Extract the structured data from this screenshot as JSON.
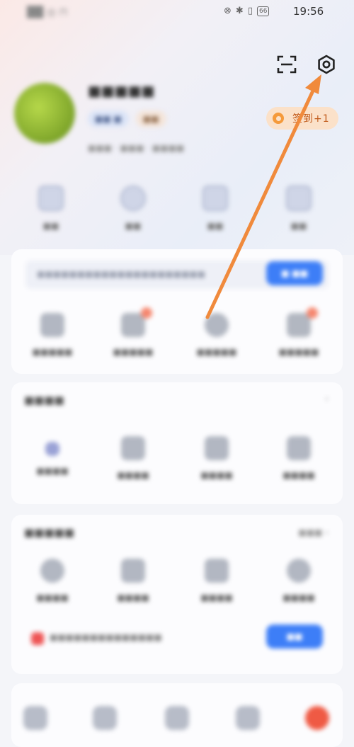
{
  "status_bar": {
    "carrier": "██ ◎ ⊓",
    "icons": [
      "mute-icon",
      "bluetooth-icon",
      "vibrate-icon"
    ],
    "battery": "66",
    "time": "19:56"
  },
  "header": {
    "scan_icon": "scan-icon",
    "settings_icon": "settings-gear-icon",
    "username": "■■■■■",
    "badges": [
      "■■ ■",
      "■■"
    ],
    "subinfo": "■■■ · ■■■ · ■■■■",
    "checkin_label": "签到+1",
    "colors": {
      "checkin_bg": "#fbe1c9",
      "checkin_text": "#c15a1a",
      "arrow": "#f08a3c"
    }
  },
  "quick_actions": [
    {
      "label": "■■",
      "icon": "home-icon"
    },
    {
      "label": "■■",
      "icon": "circle-icon"
    },
    {
      "label": "■■",
      "icon": "calendar-icon"
    },
    {
      "label": "■■",
      "icon": "document-icon"
    }
  ],
  "card1": {
    "banner_text": "■■■■■■■■■■■■■■■■■■■■■",
    "button": "■ ■■",
    "items": [
      {
        "label": "■■■■■",
        "icon": "tool-icon",
        "dot": false
      },
      {
        "label": "■■■■■",
        "icon": "gift-icon",
        "dot": true
      },
      {
        "label": "■■■■■",
        "icon": "service-icon",
        "dot": false
      },
      {
        "label": "■■■■■",
        "icon": "wallet-icon",
        "dot": true
      }
    ]
  },
  "card2": {
    "title": "■■■■",
    "more": "",
    "items": [
      {
        "label": "■■■■",
        "icon": "star-icon"
      },
      {
        "label": "■■■■",
        "icon": "bag-icon"
      },
      {
        "label": "■■■■",
        "icon": "calendar-icon"
      },
      {
        "label": "■■■■",
        "icon": "grid-icon"
      }
    ]
  },
  "card3": {
    "title": "■■■■■",
    "more": "■■■ ›",
    "items": [
      {
        "label": "■■■■",
        "icon": "box-icon"
      },
      {
        "label": "■■■■",
        "icon": "list-icon"
      },
      {
        "label": "■■■■",
        "icon": "chat-icon"
      },
      {
        "label": "■■■■",
        "icon": "clock-icon"
      }
    ],
    "invite_text": "■■■■■■■■■■■■■■",
    "invite_button": "■■"
  },
  "tab_bar": {
    "tabs": [
      {
        "icon": "home-icon"
      },
      {
        "icon": "discover-icon"
      },
      {
        "icon": "community-icon"
      },
      {
        "icon": "message-icon"
      },
      {
        "icon": "profile-icon"
      }
    ]
  }
}
